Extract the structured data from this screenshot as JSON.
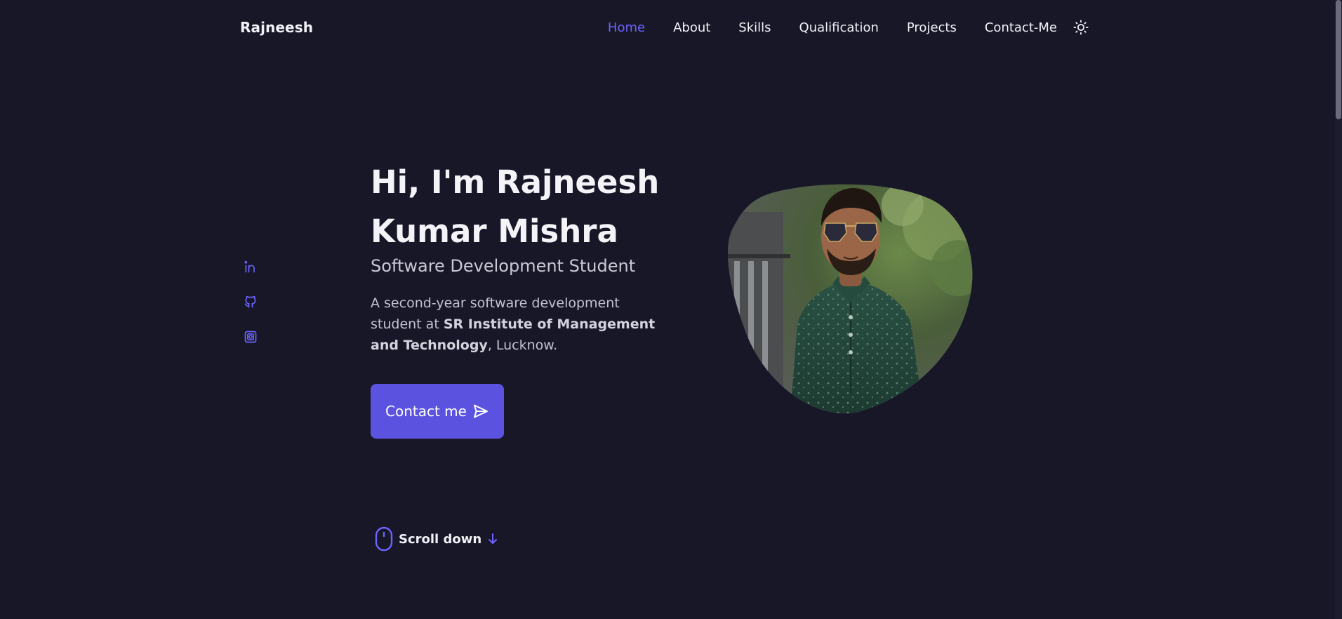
{
  "header": {
    "logo": "Rajneesh",
    "nav": [
      {
        "label": "Home",
        "active": true
      },
      {
        "label": "About",
        "active": false
      },
      {
        "label": "Skills",
        "active": false
      },
      {
        "label": "Qualification",
        "active": false
      },
      {
        "label": "Projects",
        "active": false
      },
      {
        "label": "Contact-Me",
        "active": false
      }
    ],
    "theme_icon": "sun-icon"
  },
  "social": [
    {
      "icon": "linkedin-icon"
    },
    {
      "icon": "github-icon"
    },
    {
      "icon": "instagram-icon"
    }
  ],
  "hero": {
    "title_line1": "Hi, I'm Rajneesh",
    "title_line2": "Kumar Mishra",
    "subtitle": "Software Development Student",
    "desc_part1": "A second-year software development student at ",
    "desc_bold": "SR Institute of Management and Technology",
    "desc_part2": ", Lucknow.",
    "contact_label": "Contact me",
    "contact_icon": "send-icon"
  },
  "scroll": {
    "label": "Scroll down",
    "mouse_icon": "mouse-icon",
    "arrow_icon": "arrow-down-icon"
  },
  "colors": {
    "background": "#181728",
    "accent": "#5b53e0",
    "active_nav": "#6c63ff",
    "text": "#f1f1f6"
  }
}
